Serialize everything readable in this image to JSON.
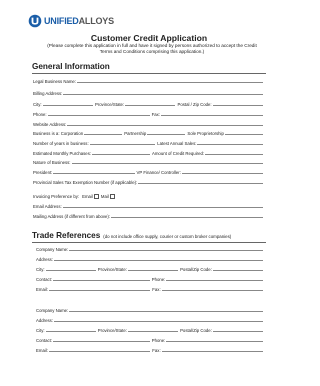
{
  "logo": {
    "part1": "UNIFIED",
    "part2": "ALLOYS",
    "color_primary": "#1b5ea8",
    "color_secondary": "#555555"
  },
  "title": "Customer Credit Application",
  "subtitle": "(Please complete this application in full and have it signed by persons authorized to accept the Credit Terms and Conditions comprising this application.)",
  "general": {
    "heading": "General Information",
    "legal_business_name": "Legal Business Name:",
    "billing_address": "Billing Address:",
    "city": "City:",
    "province_state": "Province/State:",
    "postal_zip": "Postal / Zip Code:",
    "phone": "Phone:",
    "fax": "Fax:",
    "website": "Website Address:",
    "business_is_a": "Business is a: Corporation",
    "partnership": "Partnership",
    "sole_proprietorship": "Sole Proprietorship",
    "years_in_business": "Number of years in business:",
    "latest_annual_sales": "Latest Annual Sales:",
    "estimated_monthly_purchases": "Estimated Monthly Purchases:",
    "amount_of_credit": "Amount of Credit Required:",
    "nature_of_business": "Nature of Business:",
    "president": "President:",
    "vp_finance": "VP Finance/ Controller:",
    "tax_exemption": "Provincial Sales Tax Exemption Number (if applicable):",
    "invoicing_pref": "Invoicing Preference by:",
    "email_opt": "Email",
    "mail_opt": "Mail",
    "email_address": "Email Address:",
    "mailing_address": "Mailing Address (if different from above):"
  },
  "trade": {
    "heading": "Trade References",
    "note": "(do not include office supply, courier or custom broker companies)",
    "company_name": "Company Name:",
    "address": "Address:",
    "city": "City:",
    "province_state": "Province/State:",
    "postal_zip": "Postal/Zip Code:",
    "contact": "Contact:",
    "phone": "Phone:",
    "email": "Email:",
    "fax": "Fax:"
  }
}
